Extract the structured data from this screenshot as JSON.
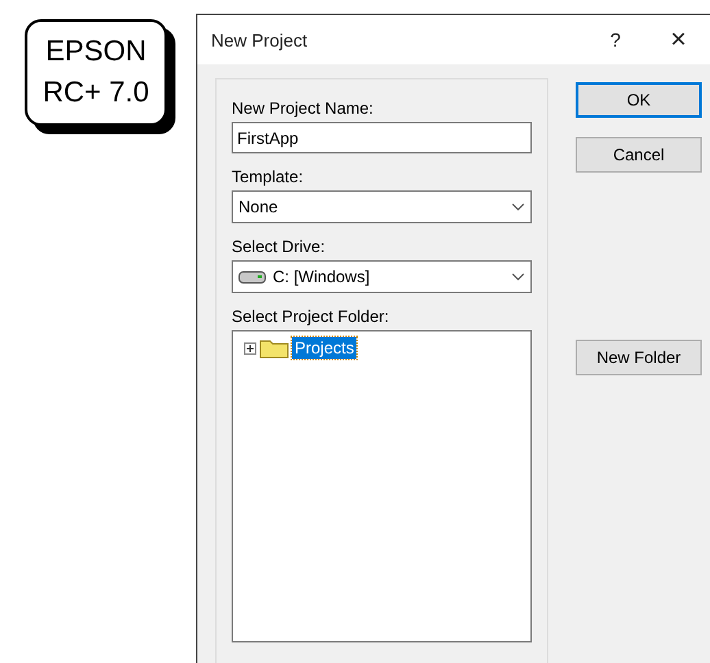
{
  "badge": {
    "lines": [
      "EPSON",
      "RC+ 7.0"
    ]
  },
  "window": {
    "title": "New Project",
    "help": "?",
    "close": "×"
  },
  "fields": [
    {
      "kind": "text",
      "label": "New Project Name:",
      "value": "FirstApp"
    },
    {
      "kind": "dropdown",
      "label": "Template:",
      "value": "None"
    },
    {
      "kind": "drive",
      "label": "Select Drive:",
      "value": "C: [Windows]"
    }
  ],
  "folder_tree": {
    "label": "Select Project Folder:",
    "items": [
      {
        "label": "Projects",
        "selected": true,
        "expanded": false
      }
    ]
  },
  "buttons": [
    {
      "kind": "dialog",
      "label": "OK",
      "default": true
    },
    {
      "kind": "dialog",
      "label": "Cancel",
      "default": false
    },
    {
      "kind": "folder",
      "label": "New Folder",
      "default": false
    }
  ]
}
